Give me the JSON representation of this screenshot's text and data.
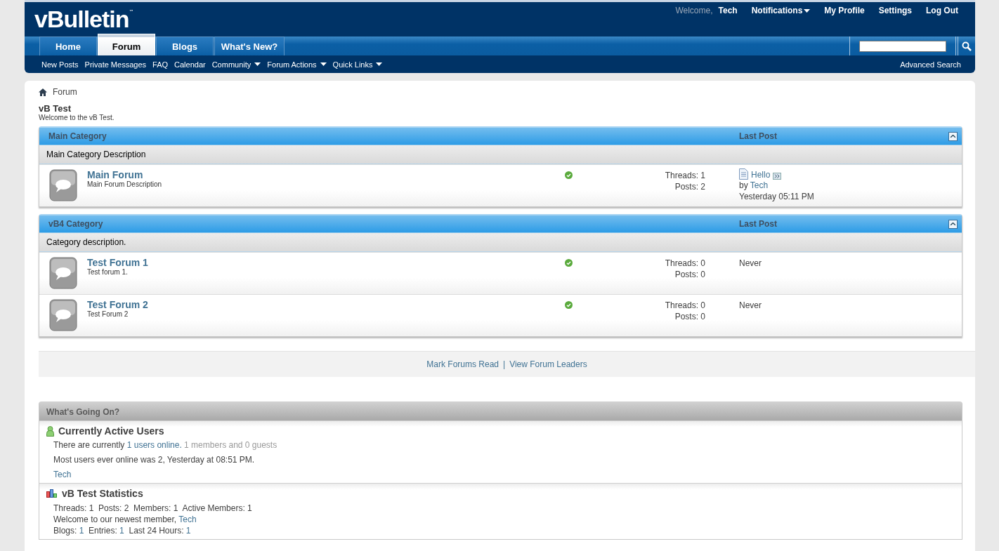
{
  "header": {
    "logo": "vBulletin",
    "trademark": "™",
    "welcome": "Welcome,",
    "user": "Tech",
    "links": [
      {
        "label": "Notifications",
        "dropdown": true
      },
      {
        "label": "My Profile",
        "dropdown": false
      },
      {
        "label": "Settings",
        "dropdown": false
      },
      {
        "label": "Log Out",
        "dropdown": false
      }
    ]
  },
  "tabs": [
    {
      "label": "Home",
      "selected": false
    },
    {
      "label": "Forum",
      "selected": true
    },
    {
      "label": "Blogs",
      "selected": false
    },
    {
      "label": "What's New?",
      "selected": false
    }
  ],
  "subnav": [
    {
      "label": "New Posts",
      "dropdown": false
    },
    {
      "label": "Private Messages",
      "dropdown": false
    },
    {
      "label": "FAQ",
      "dropdown": false
    },
    {
      "label": "Calendar",
      "dropdown": false
    },
    {
      "label": "Community",
      "dropdown": true
    },
    {
      "label": "Forum Actions",
      "dropdown": true
    },
    {
      "label": "Quick Links",
      "dropdown": true
    }
  ],
  "advanced_search": "Advanced Search",
  "breadcrumb": "Forum",
  "site_title": "vB Test",
  "site_description": "Welcome to the vB Test.",
  "categories": [
    {
      "title": "Main Category",
      "last_post_heading": "Last Post",
      "description": "Main Category Description",
      "forums": [
        {
          "name": "Main Forum",
          "description": "Main Forum Description",
          "threads": "Threads: 1",
          "posts": "Posts: 2",
          "last_post": {
            "kind": "post",
            "title": "Hello",
            "by": "by",
            "author": "Tech",
            "time": "Yesterday 05:11 PM"
          }
        }
      ]
    },
    {
      "title": "vB4 Category",
      "last_post_heading": "Last Post",
      "description": "Category description.",
      "forums": [
        {
          "name": "Test Forum 1",
          "description": "Test forum 1.",
          "threads": "Threads: 0",
          "posts": "Posts: 0",
          "last_post": {
            "kind": "never",
            "text": "Never"
          }
        },
        {
          "name": "Test Forum 2",
          "description": "Test Forum 2",
          "threads": "Threads: 0",
          "posts": "Posts: 0",
          "last_post": {
            "kind": "never",
            "text": "Never"
          }
        }
      ]
    }
  ],
  "forum_links": {
    "items": [
      "Mark Forums Read",
      "View Forum Leaders"
    ],
    "separator": "|"
  },
  "whats_going_on": {
    "title": "What's Going On?",
    "sections": [
      {
        "kind": "users",
        "title": "Currently Active Users",
        "intro": "There are currently",
        "online_link": "1 users online.",
        "breakdown": "1 members and 0 guests",
        "record": "Most users ever online was 2, Yesterday at 08:51 PM.",
        "users": [
          "Tech"
        ]
      },
      {
        "kind": "stats",
        "title": "vB Test Statistics",
        "counts": "Threads: 1  Posts: 2  Members: 1  Active Members: 1",
        "welcome": "Welcome to our newest member,",
        "newest": "Tech",
        "blog_stats": [
          {
            "label": "Blogs:",
            "value": "1"
          },
          {
            "label": "Entries:",
            "value": "1"
          },
          {
            "label": "Last 24 Hours:",
            "value": "1"
          }
        ]
      }
    ]
  }
}
